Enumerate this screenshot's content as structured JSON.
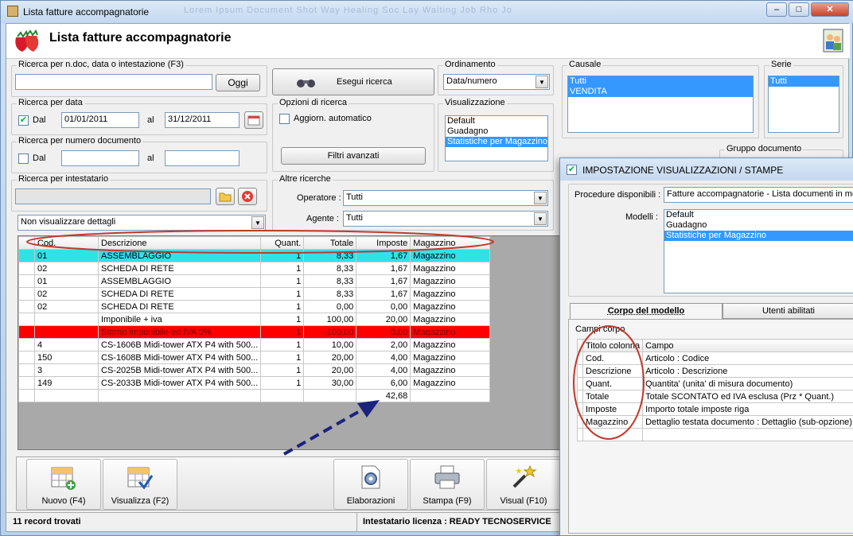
{
  "window": {
    "title": "Lista fatture accompagnatorie",
    "menu_ghost": "Lorem   Ipsum   Document   Shot   Way   Healing   Soc   Lay   Waiting   Job   Rho   Jo"
  },
  "header": {
    "title": "Lista fatture accompagnatorie"
  },
  "search_doc": {
    "label": "Ricerca per n.doc, data o intestazione (F3)",
    "value": "",
    "today_button": "Oggi"
  },
  "execute_button": "Esegui ricerca",
  "search_date": {
    "label": "Ricerca per data",
    "from_label": "Dal",
    "from_value": "01/01/2011",
    "to_label": "al",
    "to_value": "31/12/2011"
  },
  "search_number": {
    "label": "Ricerca per numero documento",
    "from_label": "Dal",
    "to_label": "al"
  },
  "search_holder": {
    "label": "Ricerca per intestatario"
  },
  "options": {
    "label": "Opzioni di ricerca",
    "auto_update": "Aggiorn. automatico",
    "advanced_filters": "Filtri avanzati"
  },
  "other": {
    "label": "Altre ricerche",
    "operator_label": "Operatore :",
    "operator_value": "Tutti",
    "agent_label": "Agente :",
    "agent_value": "Tutti"
  },
  "detail_combo": "Non visualizzare dettagli",
  "ordering": {
    "label": "Ordinamento",
    "value": "Data/numero"
  },
  "view": {
    "label": "Visualizzazione",
    "items": [
      "Default",
      "Guadagno",
      "Statistiche per Magazzino"
    ]
  },
  "causale": {
    "label": "Causale",
    "items": [
      "Tutti",
      "VENDITA"
    ]
  },
  "serie": {
    "label": "Serie",
    "items": [
      "Tutti"
    ]
  },
  "doc_group": {
    "label": "Gruppo documento"
  },
  "grid": {
    "headers": [
      "Cod.",
      "Descrizione",
      "Quant.",
      "Totale",
      "Imposte",
      "Magazzino"
    ],
    "rows": [
      [
        "01",
        "ASSEMBLAGGIO",
        "1",
        "8,33",
        "1,67",
        "Magazzino"
      ],
      [
        "02",
        "SCHEDA DI RETE",
        "1",
        "8,33",
        "1,67",
        "Magazzino"
      ],
      [
        "01",
        "ASSEMBLAGGIO",
        "1",
        "8,33",
        "1,67",
        "Magazzino"
      ],
      [
        "02",
        "SCHEDA DI RETE",
        "1",
        "8,33",
        "1,67",
        "Magazzino"
      ],
      [
        "02",
        "SCHEDA DI RETE",
        "1",
        "0,00",
        "0,00",
        "Magazzino"
      ],
      [
        "",
        "Imponibile + iva",
        "1",
        "100,00",
        "20,00",
        "Magazzino"
      ],
      [
        "",
        "Storno imponibile ed IVA 0%",
        "1",
        "-100,00",
        "0,00",
        "Magazzino"
      ],
      [
        "4",
        "CS-1606B Midi-tower ATX P4 with 500...",
        "1",
        "10,00",
        "2,00",
        "Magazzino"
      ],
      [
        "150",
        "CS-1608B Midi-tower ATX P4 with 500...",
        "1",
        "20,00",
        "4,00",
        "Magazzino"
      ],
      [
        "3",
        "CS-2025B Midi-tower ATX P4 with 500...",
        "1",
        "20,00",
        "4,00",
        "Magazzino"
      ],
      [
        "149",
        "CS-2033B Midi-tower ATX P4 with 500...",
        "1",
        "30,00",
        "6,00",
        "Magazzino"
      ]
    ],
    "total_imposte": "42,68"
  },
  "toolbar": {
    "new": "Nuovo (F4)",
    "view": "Visualizza (F2)",
    "process": "Elaborazioni",
    "print": "Stampa (F9)",
    "visual": "Visual (F10)"
  },
  "status": {
    "records": "11 record trovati",
    "license": "Intestatario licenza : READY TECNOSERVICE"
  },
  "dialog": {
    "title": "IMPOSTAZIONE VISUALIZZAZIONI / STAMPE",
    "procedures_label": "Procedure disponibili :",
    "procedures_value": "Fatture accompagnatorie - Lista documenti in modalità",
    "models_label": "Modelli :",
    "models": [
      "Default",
      "Guadagno",
      "Statistiche per Magazzino"
    ],
    "tab_body": "Corpo del modello",
    "tab_users": "Utenti abilitati",
    "fields_label": "Campi corpo",
    "field_headers": [
      "Titolo colonna",
      "Campo"
    ],
    "fields": [
      [
        "Cod.",
        "Articolo : Codice"
      ],
      [
        "Descrizione",
        "Articolo : Descrizione"
      ],
      [
        "Quant.",
        "Quantita' (unita' di misura documento)"
      ],
      [
        "Totale",
        "Totale SCONTATO ed IVA esclusa (Prz * Quant.)"
      ],
      [
        "Imposte",
        "Importo totale imposte riga"
      ],
      [
        "Magazzino",
        "Dettaglio testata documento : Dettaglio (sub-opzione)"
      ]
    ]
  },
  "colors": {
    "highlight": "#3399ff",
    "cyan_row": "#33e0e8",
    "red_row": "#ff0000",
    "annotation": "#c0392b",
    "arrow": "#1a237e"
  }
}
